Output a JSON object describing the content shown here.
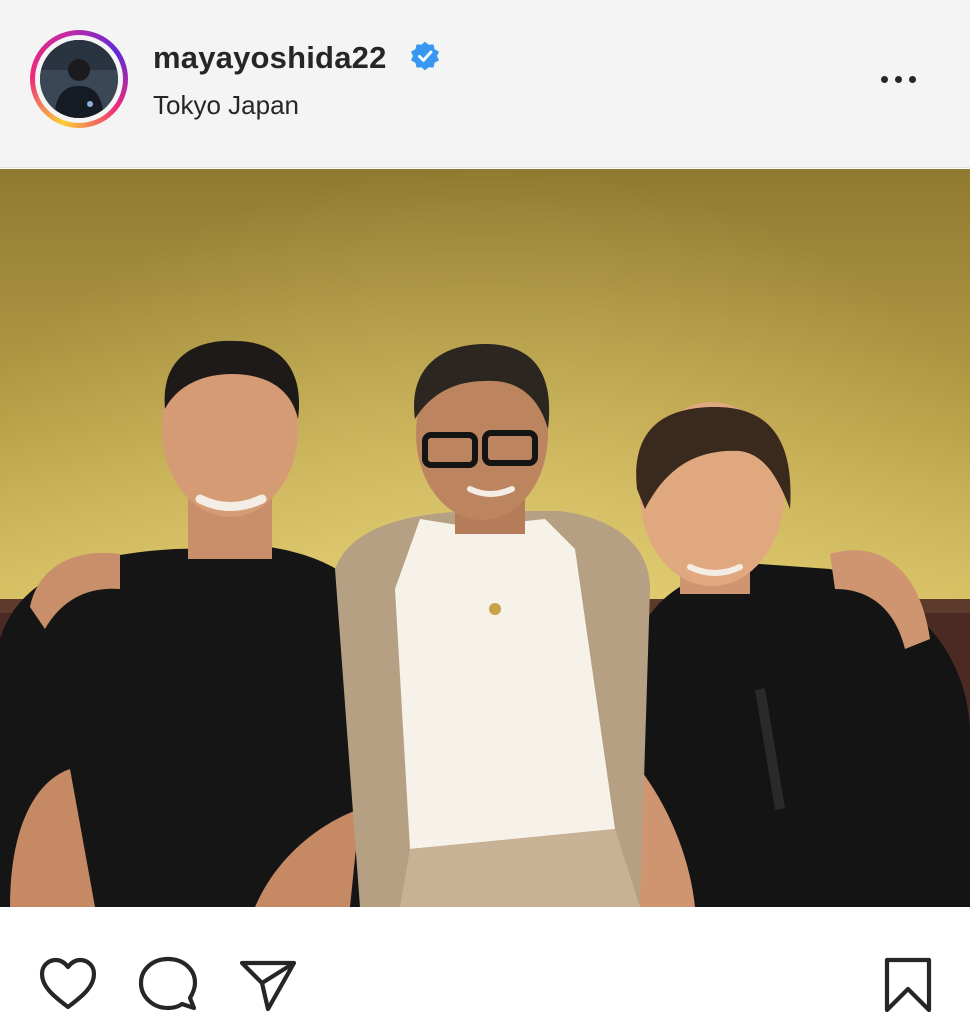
{
  "post": {
    "username": "mayayoshida22",
    "location": "Tokyo Japan",
    "verified": true
  },
  "icons": {
    "avatar": "profile-photo",
    "verified": "verified-badge-icon",
    "more": "more-options-icon",
    "like": "heart-icon",
    "comment": "comment-bubble-icon",
    "share": "paper-plane-icon",
    "save": "bookmark-icon"
  },
  "colors": {
    "verified_blue": "#3897f0",
    "ring_gradient": [
      "#f9ce34",
      "#ee2a7b",
      "#6228d7"
    ],
    "header_bg": "#f4f4f4",
    "text": "#262626"
  }
}
